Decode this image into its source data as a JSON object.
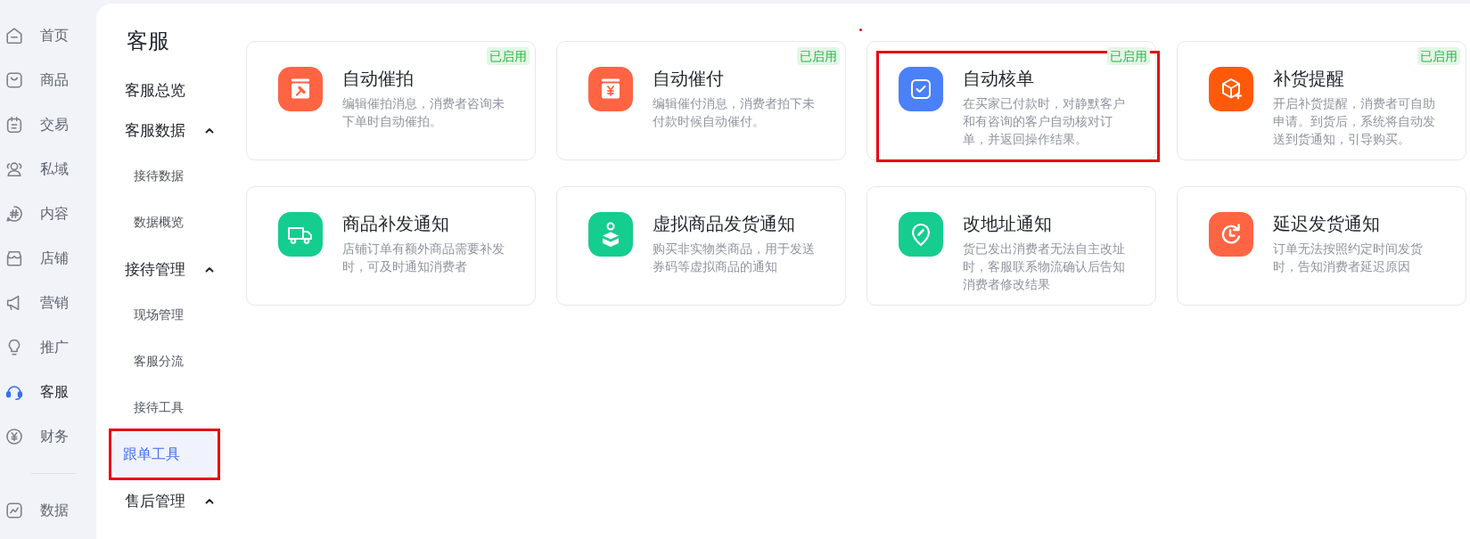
{
  "nav": {
    "items": [
      {
        "label": "首页",
        "selected": false
      },
      {
        "label": "商品",
        "selected": false
      },
      {
        "label": "交易",
        "selected": false
      },
      {
        "label": "私域",
        "selected": false
      },
      {
        "label": "内容",
        "selected": false
      },
      {
        "label": "店铺",
        "selected": false
      },
      {
        "label": "营销",
        "selected": false
      },
      {
        "label": "推广",
        "selected": false
      },
      {
        "label": "客服",
        "selected": true
      },
      {
        "label": "财务",
        "selected": false
      }
    ],
    "bottom_items": [
      {
        "label": "数据",
        "selected": false
      }
    ]
  },
  "sidebar": {
    "title": "客服",
    "items": [
      {
        "label": "客服总览",
        "selected": false,
        "outlined": false
      },
      {
        "label": "客服数据",
        "selected": false,
        "outlined": false,
        "expanded": true,
        "children": [
          {
            "label": "接待数据",
            "selected": false,
            "outlined": false
          },
          {
            "label": "数据概览",
            "selected": false,
            "outlined": false
          }
        ]
      },
      {
        "label": "接待管理",
        "selected": false,
        "outlined": false,
        "expanded": true,
        "children": [
          {
            "label": "现场管理",
            "selected": false,
            "outlined": false
          },
          {
            "label": "客服分流",
            "selected": false,
            "outlined": false
          },
          {
            "label": "接待工具",
            "selected": false,
            "outlined": false
          },
          {
            "label": "跟单工具",
            "selected": true,
            "outlined": true
          }
        ]
      },
      {
        "label": "售后管理",
        "selected": false,
        "outlined": false,
        "expanded": true
      }
    ]
  },
  "cards": [
    {
      "title": "自动催拍",
      "description": "编辑催拍消息，消费者咨询未下单时自动催拍。",
      "badge": "已启用",
      "color": "#ff6443",
      "outlined": false
    },
    {
      "title": "自动催付",
      "description": "编辑催付消息，消费者拍下未付款时候自动催付。",
      "badge": "已启用",
      "color": "#ff6443",
      "outlined": false
    },
    {
      "title": "自动核单",
      "description": "在买家已付款时，对静默客户和有咨询的客户自动核对订单，并返回操作结果。",
      "badge": "已启用",
      "color": "#4a80f8",
      "outlined": true
    },
    {
      "title": "补货提醒",
      "description": "开启补货提醒，消费者可自助申请。到货后，系统将自动发送到货通知，引导购买。",
      "badge": "已启用",
      "color": "#ff5a0a",
      "outlined": false
    },
    {
      "title": "商品补发通知",
      "description": "店铺订单有额外商品需要补发时，可及时通知消费者",
      "color": "#15cd8f",
      "outlined": false
    },
    {
      "title": "虚拟商品发货通知",
      "description": "购买非实物类商品，用于发送券码等虚拟商品的通知",
      "color": "#15cd8f",
      "outlined": false
    },
    {
      "title": "改地址通知",
      "description": "货已发出消费者无法自主改址时，客服联系物流确认后告知消费者修改结果",
      "color": "#15cd8f",
      "outlined": false
    },
    {
      "title": "延迟发货通知",
      "description": "订单无法按照约定时间发货时，告知消费者延迟原因",
      "color": "#ff6443",
      "outlined": false
    }
  ]
}
